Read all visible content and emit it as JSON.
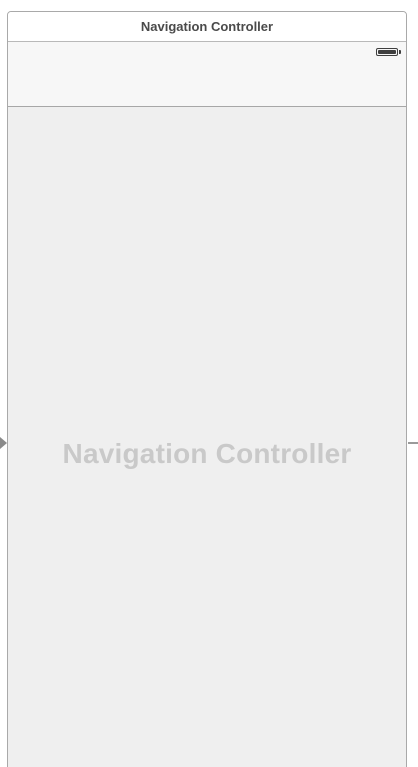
{
  "scene": {
    "title": "Navigation Controller",
    "content_label": "Navigation Controller"
  },
  "status_bar": {
    "battery_icon": "battery-icon",
    "battery_level": 1.0
  },
  "colors": {
    "scene_background": "#efefef",
    "nav_bar_background": "#f7f7f7",
    "title_text": "#4a4a4a",
    "watermark_text": "#c9c9c9",
    "border": "#a9a9a9"
  }
}
